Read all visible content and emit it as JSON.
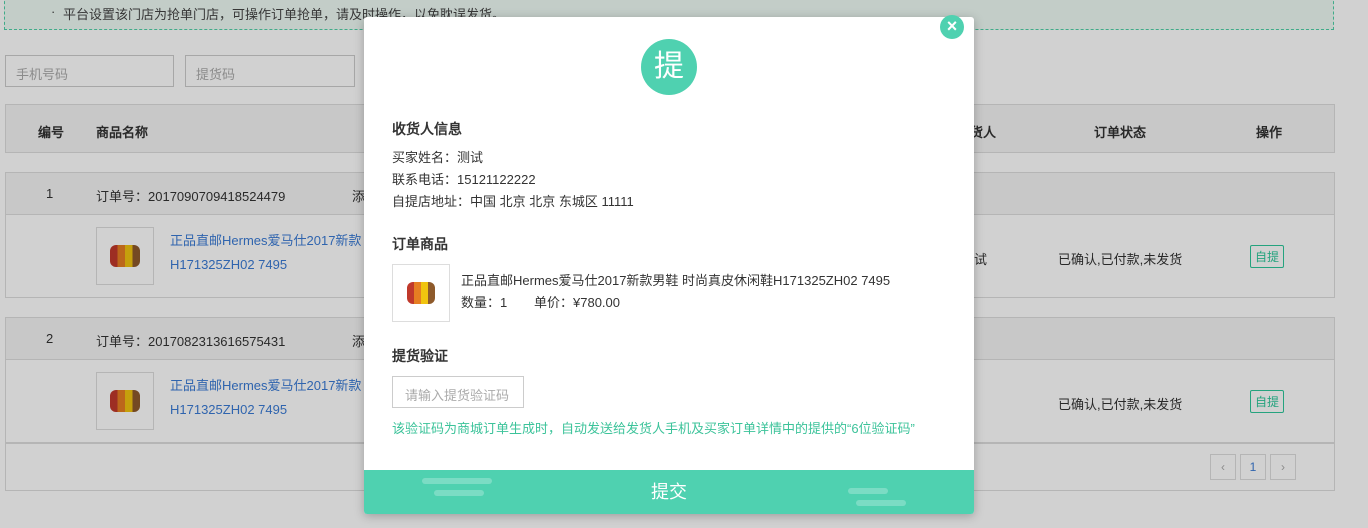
{
  "notice": {
    "text": "平台设置该门店为抢单门店，可操作订单抢单，请及时操作，以免耽误发货。",
    "dot": "·"
  },
  "filters": {
    "phone_placeholder": "手机号码",
    "pickup_placeholder": "提货码"
  },
  "table": {
    "headers": {
      "index": "编号",
      "product": "商品名称",
      "consignee": "货人",
      "status": "订单状态",
      "action": "操作"
    },
    "orders": [
      {
        "index": "1",
        "order_no": "订单号：2017090709418524479",
        "added": "添",
        "product_line1": "正品直邮Hermes爱马仕2017新款",
        "product_line2": "H171325ZH02 7495",
        "consignee": "试",
        "status": "已确认,已付款,未发货",
        "action": "自提"
      },
      {
        "index": "2",
        "order_no": "订单号：2017082313616575431",
        "added": "添",
        "product_line1": "正品直邮Hermes爱马仕2017新款",
        "product_line2": "H171325ZH02 7495",
        "consignee": "",
        "status": "已确认,已付款,未发货",
        "action": "自提"
      }
    ]
  },
  "pager": {
    "prev": "‹",
    "current": "1",
    "next": "›"
  },
  "modal": {
    "badge": "提",
    "close": "×",
    "receiver_title": "收货人信息",
    "buyer_name": "买家姓名：测试",
    "phone": "联系电话：15121122222",
    "address": "自提店地址：中国 北京 北京 东城区 11111",
    "goods_title": "订单商品",
    "goods_name": "正品直邮Hermes爱马仕2017新款男鞋 时尚真皮休闲鞋H171325ZH02 7495",
    "qty": "数量：1",
    "price": "单价：¥780.00",
    "verify_title": "提货验证",
    "verify_placeholder": "请输入提货验证码",
    "hint": "该验证码为商城订单生成时，自动发送给发货人手机及买家订单详情中的提供的“6位验证码”",
    "submit": "提交"
  },
  "colors": {
    "accent": "#4fd1b0",
    "link": "#3a7bd5"
  }
}
